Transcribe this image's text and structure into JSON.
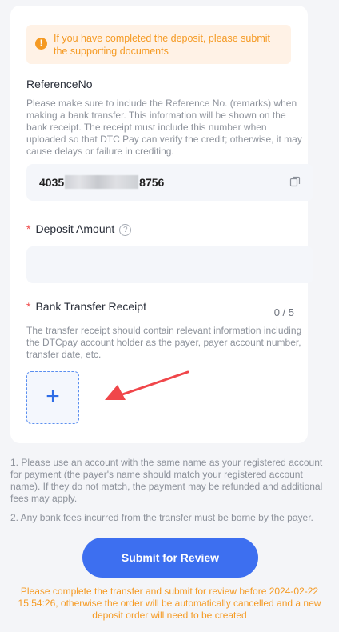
{
  "alert": {
    "icon": "exclamation-icon",
    "text": "If you have completed the deposit, please submit the supporting documents"
  },
  "reference": {
    "label": "ReferenceNo",
    "help": "Please make sure to include the Reference No. (remarks) when making a bank transfer. This information will be shown on the bank receipt. The receipt must include this number when uploaded so that DTC Pay can verify the credit; otherwise, it may cause delays or failure in crediting.",
    "value_prefix": "4035",
    "value_suffix": "8756",
    "copy_icon": "copy-icon"
  },
  "deposit": {
    "required_mark": "*",
    "label": "Deposit Amount",
    "help_icon": "question-icon",
    "value": ""
  },
  "receipt": {
    "required_mark": "*",
    "label": "Bank Transfer Receipt",
    "count": "0 / 5",
    "help": "The transfer receipt should contain relevant information including the DTCpay account holder as the payer, payer account number, transfer date, etc.",
    "upload_glyph": "+"
  },
  "notes": [
    "1. Please use an account with the same name as your registered account for payment (the payer's name should match your registered account name). If they do not match, the payment may be refunded and additional fees may apply.",
    "2. Any bank fees incurred from the transfer must be borne by the payer."
  ],
  "submit_label": "Submit for Review",
  "deadline_text": "Please complete the transfer and submit for review before 2024-02-22 15:54:26, otherwise the order will be automatically cancelled and a new deposit order will need to be created",
  "colors": {
    "accent": "#3d6ff0",
    "warning": "#f59a23",
    "required": "#f04a4a"
  }
}
